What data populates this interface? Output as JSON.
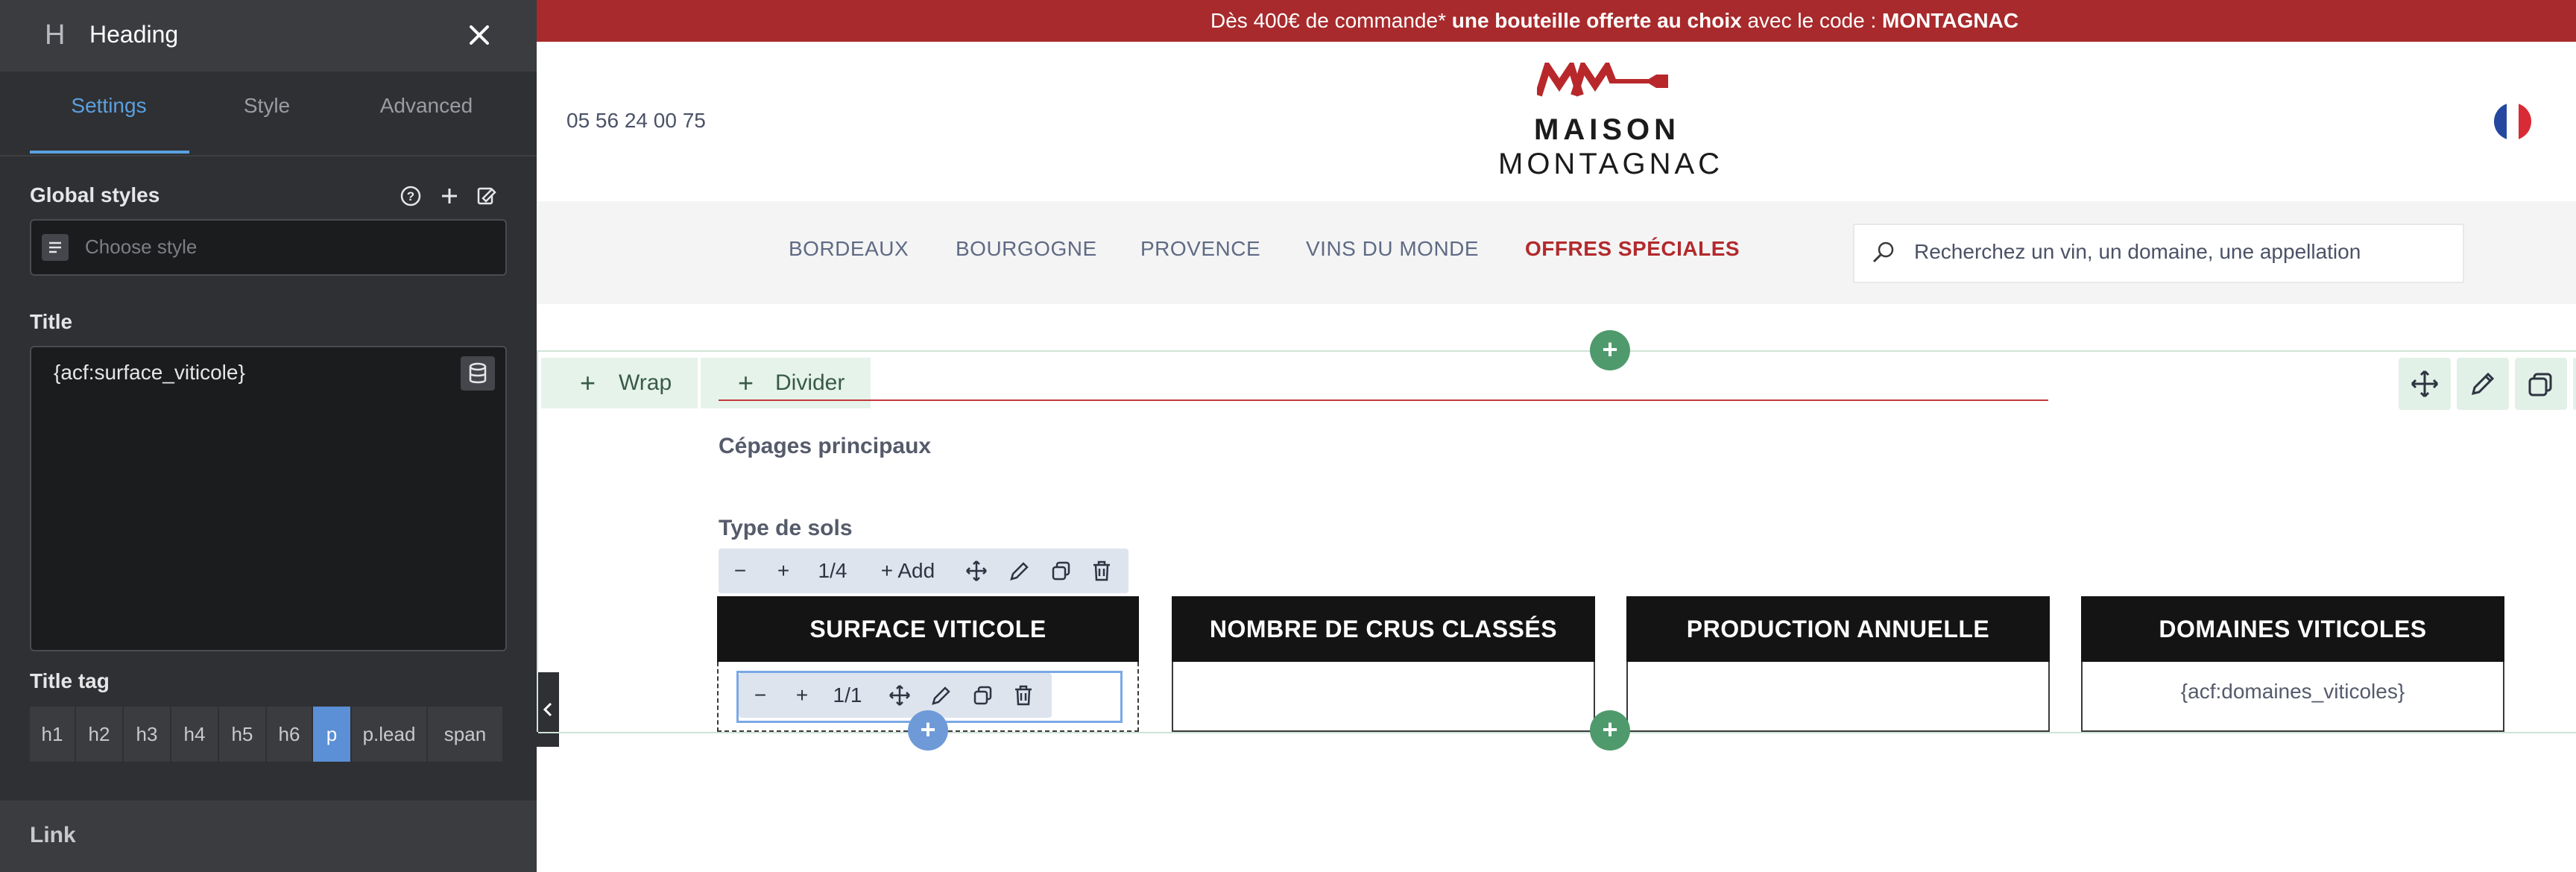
{
  "panel": {
    "title": "Heading",
    "tabs": [
      {
        "label": "Settings",
        "active": true
      },
      {
        "label": "Style",
        "active": false
      },
      {
        "label": "Advanced",
        "active": false
      }
    ],
    "global_styles_label": "Global styles",
    "global_styles_placeholder": "Choose style",
    "title_label": "Title",
    "title_value": "{acf:surface_viticole}",
    "title_tag_label": "Title tag",
    "title_tags": [
      "h1",
      "h2",
      "h3",
      "h4",
      "h5",
      "h6",
      "p",
      "p.lead",
      "span"
    ],
    "active_title_tag": "p",
    "link_label": "Link"
  },
  "site": {
    "promo": {
      "part1": "Dès 400€ de commande* ",
      "part2": "une bouteille offerte au choix",
      "part3": " avec le code : ",
      "code": "MONTAGNAC"
    },
    "phone": "05 56 24 00 75",
    "logo_line1": "MAISON",
    "logo_line2": "MONTAGNAC",
    "nav": [
      "BORDEAUX",
      "BOURGOGNE",
      "PROVENCE",
      "VINS DU MONDE",
      "OFFRES SPÉCIALES"
    ],
    "search_placeholder": "Recherchez un vin, un domaine, une appellation",
    "wrap_label": "Wrap",
    "divider_label": "Divider",
    "cepages": "Cépages principaux",
    "type_sols": "Type de sols",
    "column_toolbar": {
      "fraction": "1/4",
      "add_label": "Add"
    },
    "inner_toolbar": {
      "fraction": "1/1"
    },
    "cards": [
      {
        "title": "SURFACE VITICOLE",
        "value": ""
      },
      {
        "title": "NOMBRE DE CRUS CLASSÉS",
        "value": ""
      },
      {
        "title": "PRODUCTION ANNUELLE",
        "value": ""
      },
      {
        "title": "DOMAINES VITICOLES",
        "value": "{acf:domaines_viticoles}"
      }
    ]
  },
  "colors": {
    "promo_bg": "#a82a2c",
    "panel_bg": "#2f3033",
    "accent_blue": "#5aa0e0",
    "accent_green": "#4f9a6c",
    "special_offer": "#b22a2d"
  },
  "icons": [
    "heading-icon",
    "close-icon",
    "help-icon",
    "plus-icon",
    "style-edit-icon",
    "list-icon",
    "database-icon",
    "chevron-left-icon",
    "search-icon",
    "flag-icon",
    "move-icon",
    "edit-icon",
    "duplicate-icon",
    "trash-icon"
  ]
}
